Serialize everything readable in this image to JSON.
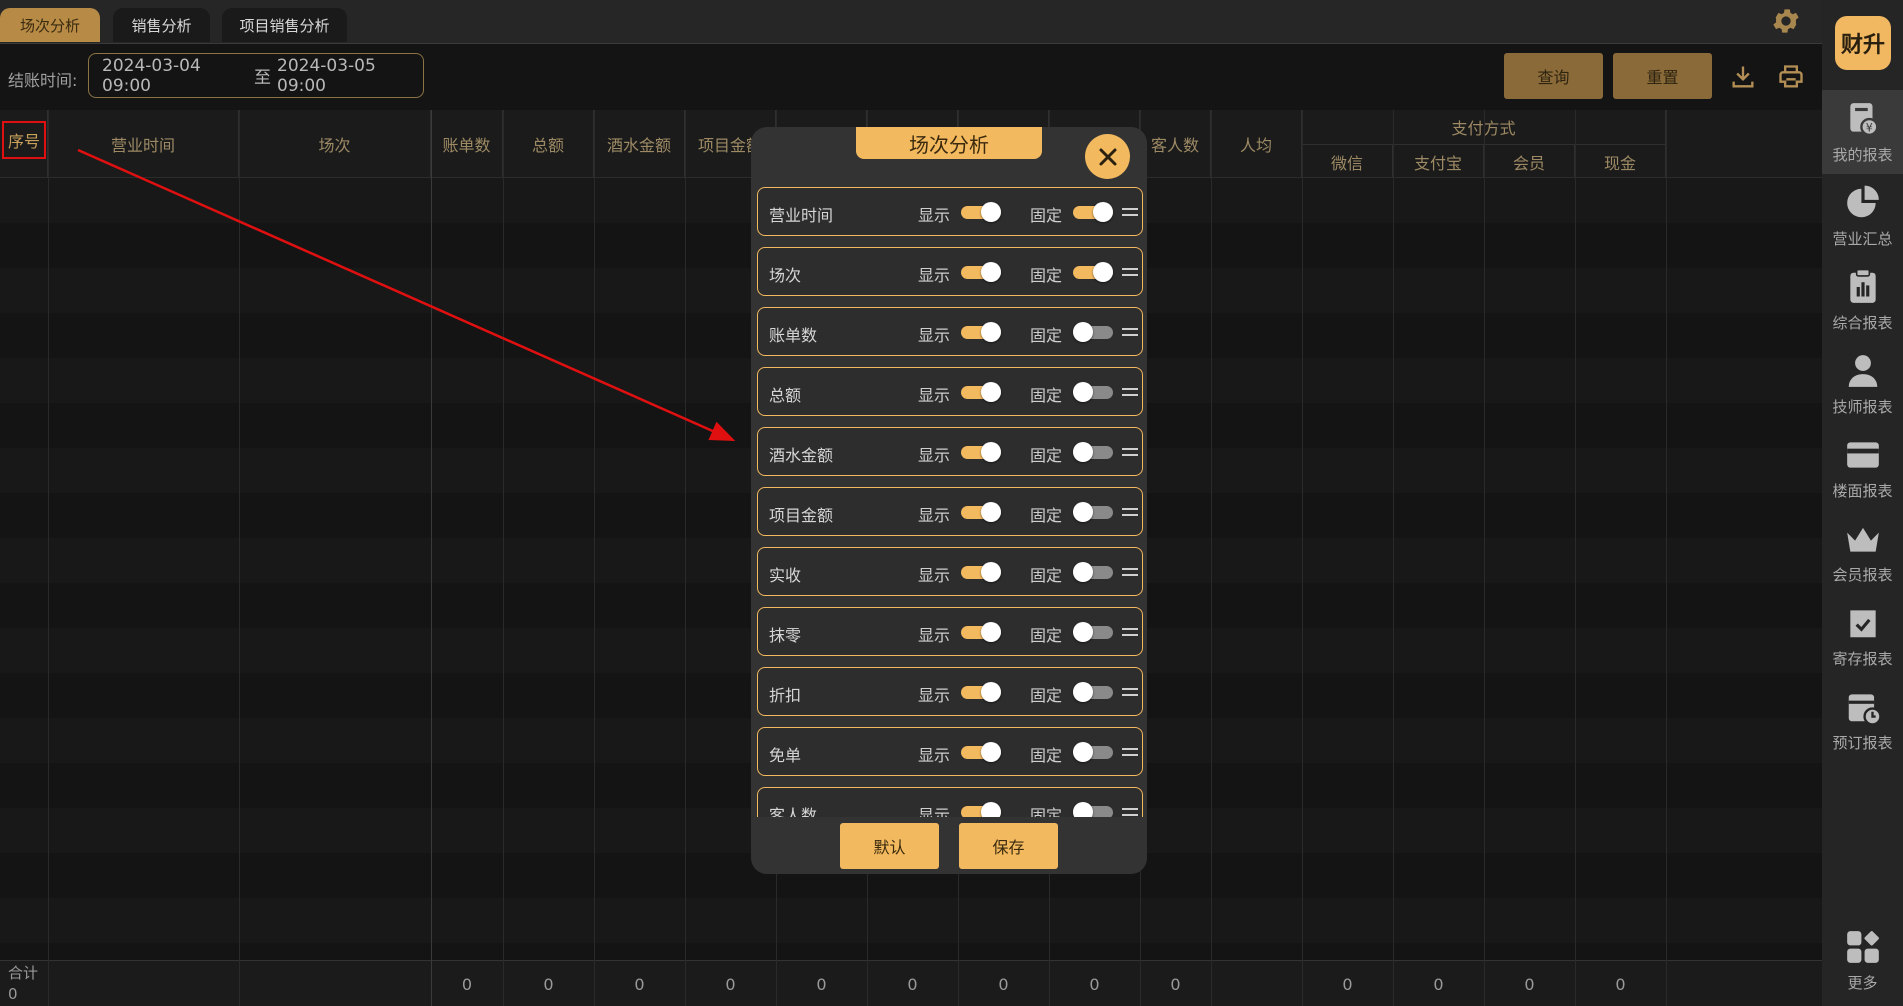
{
  "tabs": [
    {
      "label": "场次分析",
      "active": true
    },
    {
      "label": "销售分析",
      "active": false
    },
    {
      "label": "项目销售分析",
      "active": false
    }
  ],
  "filter": {
    "label": "结账时间:",
    "start": "2024-03-04 09:00",
    "sep": "至",
    "end": "2024-03-05 09:00",
    "query_label": "查询",
    "reset_label": "重置"
  },
  "table": {
    "headers": {
      "seq": "序号",
      "business_time": "营业时间",
      "session": "场次",
      "bill_count": "账单数",
      "total": "总额",
      "drinks": "酒水金额",
      "items": "项目金额",
      "guests": "客人数",
      "avg": "人均",
      "payment_group": "支付方式",
      "wechat": "微信",
      "alipay": "支付宝",
      "member": "会员",
      "cash": "现金"
    },
    "footer": {
      "label": "合计",
      "count": "0",
      "values": [
        "0",
        "0",
        "0",
        "0",
        "0",
        "0",
        "0",
        "0",
        "0",
        "0",
        "0",
        "0",
        "0"
      ]
    }
  },
  "sidebar": {
    "logo": "财升",
    "items": [
      {
        "label": "我的报表",
        "icon": "report-money-icon",
        "active": true
      },
      {
        "label": "营业汇总",
        "icon": "pie-chart-icon",
        "active": false
      },
      {
        "label": "综合报表",
        "icon": "clipboard-chart-icon",
        "active": false
      },
      {
        "label": "技师报表",
        "icon": "person-icon",
        "active": false
      },
      {
        "label": "楼面报表",
        "icon": "card-icon",
        "active": false
      },
      {
        "label": "会员报表",
        "icon": "crown-icon",
        "active": false
      },
      {
        "label": "寄存报表",
        "icon": "box-check-icon",
        "active": false
      },
      {
        "label": "预订报表",
        "icon": "calendar-clock-icon",
        "active": false
      },
      {
        "label": "更多",
        "icon": "grid-more-icon",
        "active": false
      }
    ]
  },
  "modal": {
    "title": "场次分析",
    "show_label": "显示",
    "fix_label": "固定",
    "items": [
      {
        "name": "营业时间",
        "show": true,
        "fixed": true
      },
      {
        "name": "场次",
        "show": true,
        "fixed": true
      },
      {
        "name": "账单数",
        "show": true,
        "fixed": false
      },
      {
        "name": "总额",
        "show": true,
        "fixed": false
      },
      {
        "name": "酒水金额",
        "show": true,
        "fixed": false
      },
      {
        "name": "项目金额",
        "show": true,
        "fixed": false
      },
      {
        "name": "实收",
        "show": true,
        "fixed": false
      },
      {
        "name": "抹零",
        "show": true,
        "fixed": false
      },
      {
        "name": "折扣",
        "show": true,
        "fixed": false
      },
      {
        "name": "免单",
        "show": true,
        "fixed": false
      },
      {
        "name": "客人数",
        "show": true,
        "fixed": false
      }
    ],
    "default_label": "默认",
    "save_label": "保存"
  },
  "colors": {
    "accent": "#f2b95f",
    "accent_dark": "#8a6a39",
    "annotation": "#e01010"
  }
}
